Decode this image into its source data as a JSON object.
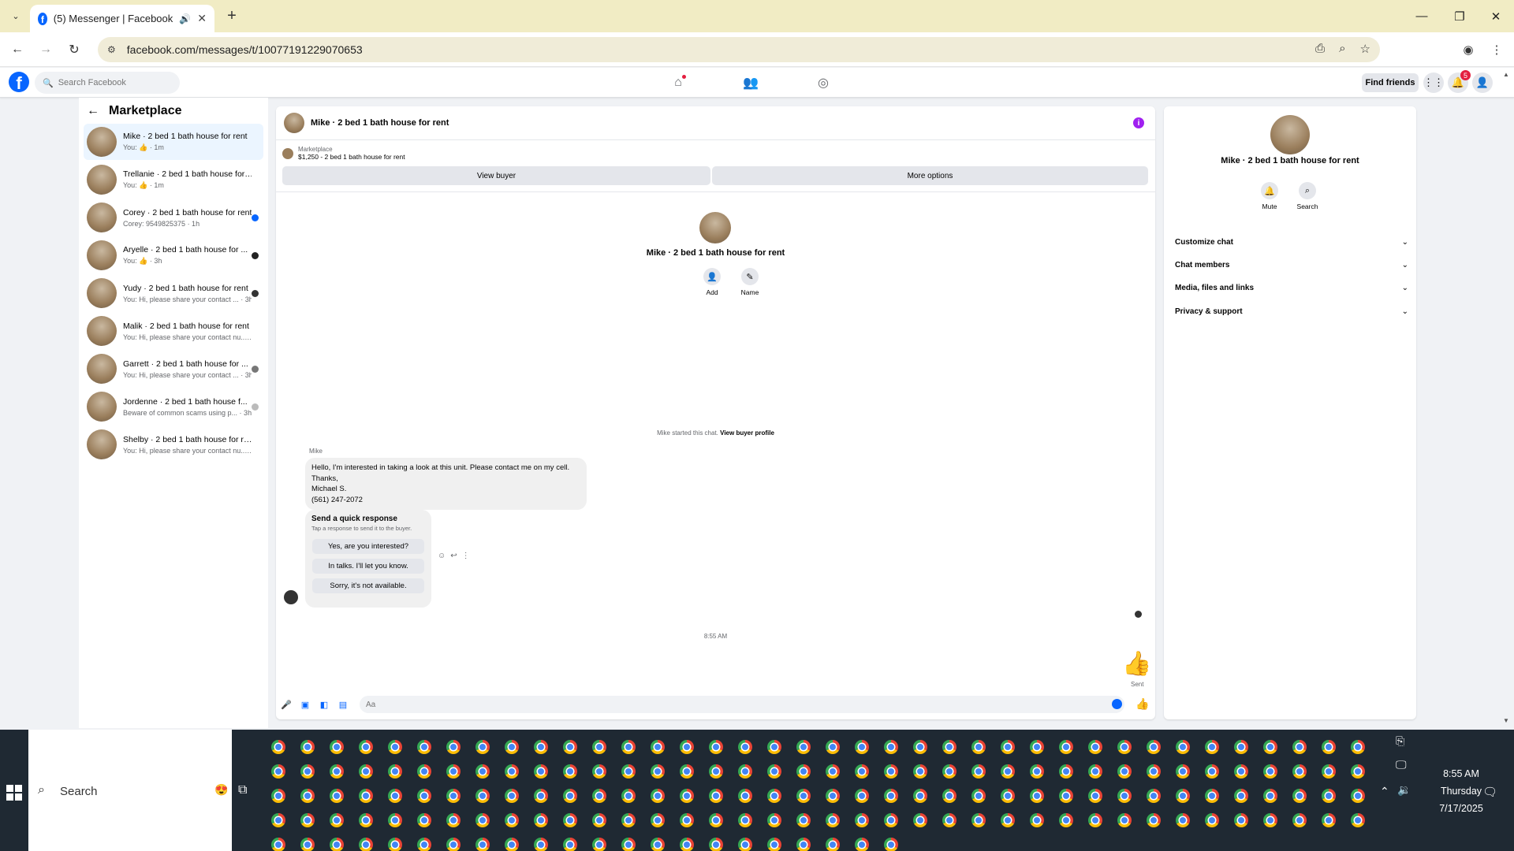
{
  "browser": {
    "tab_title": "(5) Messenger | Facebook",
    "url": "facebook.com/messages/t/10077191229070653"
  },
  "fb_header": {
    "search_placeholder": "Search Facebook",
    "find_friends": "Find friends",
    "notification_count": "5"
  },
  "left_panel": {
    "title": "Marketplace",
    "conversations": [
      {
        "name": "Mike · 2 bed 1 bath house for rent",
        "sub": "You: 👍 · 1m",
        "active": true,
        "indicator": ""
      },
      {
        "name": "Trellanie · 2 bed 1 bath house for r...",
        "sub": "You: 👍 · 1m",
        "active": false,
        "indicator": ""
      },
      {
        "name": "Corey · 2 bed 1 bath house for rent",
        "sub": "Corey: 9549825375 · 1h",
        "active": false,
        "indicator": "#0866ff"
      },
      {
        "name": "Aryelle · 2 bed 1 bath house for ...",
        "sub": "You: 👍 · 3h",
        "active": false,
        "indicator": "#222222"
      },
      {
        "name": "Yudy · 2 bed 1 bath house for rent",
        "sub": "You: Hi, please share your contact ... · 3h",
        "active": false,
        "indicator": "#333333"
      },
      {
        "name": "Malik · 2 bed 1 bath house for rent",
        "sub": "You: Hi, please share your contact nu... · 3h",
        "active": false,
        "indicator": ""
      },
      {
        "name": "Garrett · 2 bed 1 bath house for ...",
        "sub": "You: Hi, please share your contact ... · 3h",
        "active": false,
        "indicator": "#777777"
      },
      {
        "name": "Jordenne · 2 bed 1 bath house f...",
        "sub": "Beware of common scams using p... · 3h",
        "active": false,
        "indicator": "#bbbbbb"
      },
      {
        "name": "Shelby · 2 bed 1 bath house for rent",
        "sub": "You: Hi, please share your contact nu... · 3h",
        "active": false,
        "indicator": ""
      }
    ]
  },
  "chat": {
    "title": "Mike · 2 bed 1 bath house for rent",
    "marketplace_label": "Marketplace",
    "listing": "$1,250 - 2 bed 1 bath house for rent",
    "view_buyer": "View buyer",
    "more_options": "More options",
    "profile_name": "Mike · 2 bed 1 bath house for rent",
    "add_label": "Add",
    "name_label": "Name",
    "started_text": "Mike started this chat.",
    "view_buyer_profile": "View buyer profile",
    "sender": "Mike",
    "message": "Hello, I'm interested in taking a look at this unit. Please contact me on my cell.\nThanks,\nMichael S.\n(561) 247-2072",
    "quick_response_title": "Send a quick response",
    "quick_response_sub": "Tap a response to send it to the buyer.",
    "quick_responses": [
      "Yes, are you interested?",
      "In talks. I'll let you know.",
      "Sorry, it's not available."
    ],
    "time": "8:55 AM",
    "sent_label": "Sent",
    "compose_placeholder": "Aa"
  },
  "right_panel": {
    "name": "Mike · 2 bed 1 bath house for rent",
    "mute": "Mute",
    "search": "Search",
    "sections": [
      "Customize chat",
      "Chat members",
      "Media, files and links",
      "Privacy & support"
    ]
  },
  "taskbar": {
    "search_label": "Search",
    "time": "8:55 AM",
    "day": "Thursday",
    "date": "7/17/2025"
  }
}
